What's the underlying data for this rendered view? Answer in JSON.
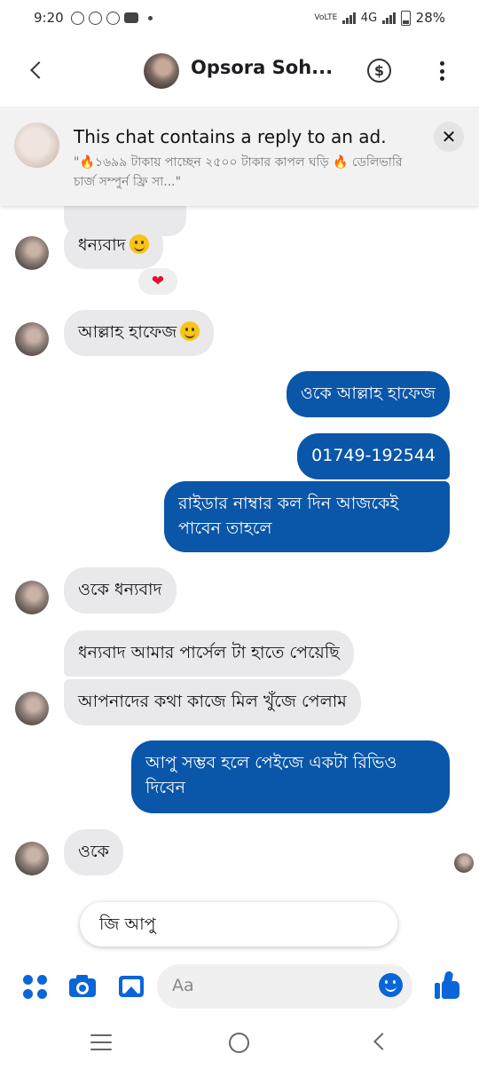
{
  "status_bar": {
    "time": "9:20",
    "network_label": "4G",
    "volte_label": "VoLTE",
    "battery_percent": "28%"
  },
  "header": {
    "contact_name": "Opsora Soh...",
    "dollar_symbol": "$"
  },
  "ad_banner": {
    "title": "This chat contains a reply to an ad.",
    "snippet": "\"🔥১৬৯৯ টাকায় পাচ্ছেন ২৫০০ টাকার কাপল ঘড়ি 🔥 ডেলিভারি চার্জ সম্পুর্ন ফ্রি সা...\"",
    "close_label": "✕"
  },
  "messages": [
    {
      "direction": "in",
      "text": "ধন্যবাদ",
      "emoji": true,
      "reaction": "❤"
    },
    {
      "direction": "in",
      "text": "আল্লাহ হাফেজ",
      "emoji": true
    },
    {
      "direction": "out",
      "text": "ওকে আল্লাহ হাফেজ"
    },
    {
      "direction": "out",
      "text": "01749-192544"
    },
    {
      "direction": "out",
      "text": "রাইডার নাম্বার কল দিন আজকেই পাবেন তাহলে"
    },
    {
      "direction": "in",
      "text": "ওকে ধন্যবাদ"
    },
    {
      "direction": "in",
      "text": "ধন্যবাদ আমার পার্সেল টা হাতে পেয়েছি"
    },
    {
      "direction": "in",
      "text": "আপনাদের কথা কাজে মিল খুঁজে পেলাম"
    },
    {
      "direction": "out",
      "text": "আপু সম্ভব হলে পেইজে একটা রিভিও দিবেন"
    },
    {
      "direction": "in",
      "text": "ওকে"
    }
  ],
  "suggested_reply": "জি আপু",
  "composer": {
    "placeholder": "Aa"
  },
  "colors": {
    "outgoing_bubble": "#0a56a8",
    "incoming_bubble": "#e9e9eb",
    "accent": "#0a66d8"
  }
}
